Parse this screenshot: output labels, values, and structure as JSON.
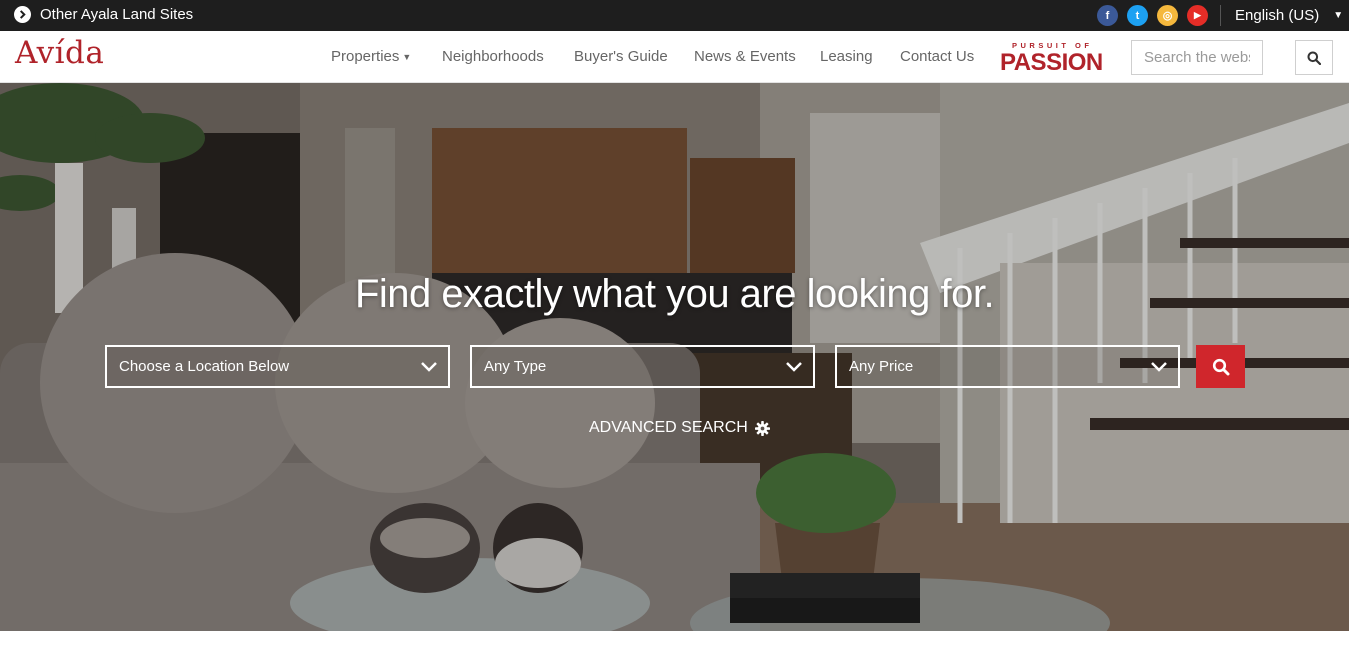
{
  "topbar": {
    "other_sites": "Other Ayala Land Sites",
    "language": "English (US)",
    "social": [
      {
        "name": "facebook",
        "glyph": "f",
        "color": "#3b5998"
      },
      {
        "name": "twitter",
        "glyph": "t",
        "color": "#1da1f2"
      },
      {
        "name": "instagram",
        "glyph": "◎",
        "color": "#f5b83d"
      },
      {
        "name": "youtube",
        "glyph": "▶",
        "color": "#e52d27"
      }
    ]
  },
  "nav": {
    "logo": "Avída",
    "items": [
      "Properties",
      "Neighborhoods",
      "Buyer's Guide",
      "News & Events",
      "Leasing",
      "Contact Us"
    ],
    "campaign": {
      "top": "PURSUIT OF",
      "main": "PASSION"
    },
    "search_placeholder": "Search the website"
  },
  "hero": {
    "title": "Find exactly what you are looking for.",
    "location_select": "Choose a Location Below",
    "type_select": "Any Type",
    "price_select": "Any Price",
    "advanced_search": "ADVANCED SEARCH"
  },
  "colors": {
    "brand_red": "#b0232a",
    "search_button_red": "#d0262c",
    "topbar_bg": "#1e1e1e"
  }
}
